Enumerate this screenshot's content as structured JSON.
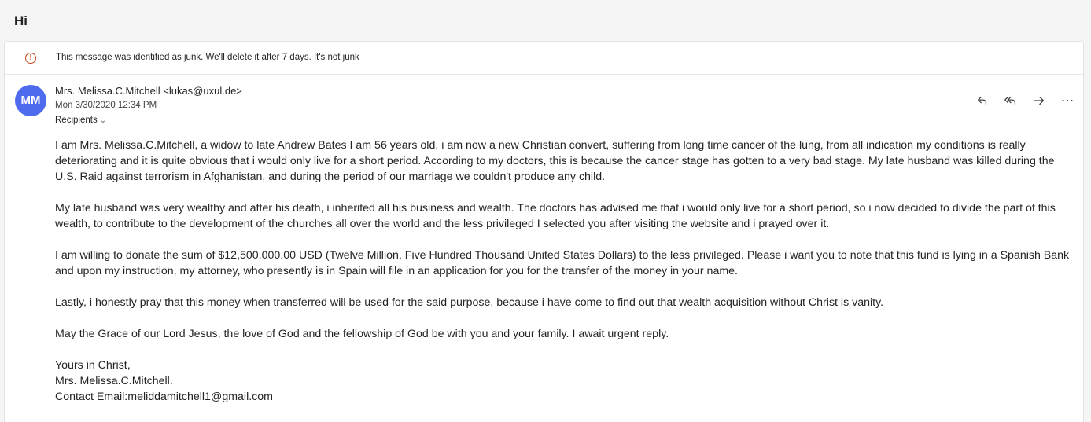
{
  "subject": "Hi",
  "junk_notice": "This message was identified as junk. We'll delete it after 7 days. It's not junk",
  "message": {
    "avatar_initials": "MM",
    "sender": "Mrs. Melissa.C.Mitchell <lukas@uxul.de>",
    "date": "Mon 3/30/2020 12:34 PM",
    "recipients_label": "Recipients",
    "actions": [
      "reply",
      "reply-all",
      "forward",
      "more"
    ],
    "paragraphs": [
      "I am Mrs. Melissa.C.Mitchell, a widow to late Andrew Bates I am 56 years old, i am now a new Christian convert, suffering from long time cancer of the lung, from all indication my conditions is really deteriorating and it is quite obvious that i would only live for a short period. According to my doctors, this is because the cancer stage has gotten to a very bad stage. My late husband was killed during the U.S. Raid against terrorism in Afghanistan, and during the period of our marriage we couldn't produce any child.",
      "My late husband was very wealthy and after his death, i inherited all his business and wealth. The doctors has advised me that i would only live for a short period, so i now decided to divide the part of this wealth, to contribute to the development of the churches all over the world and the less privileged I selected you after visiting the website and i prayed over it.",
      "I am willing to donate the sum of $12,500,000.00 USD (Twelve Million, Five Hundred Thousand United States Dollars) to the less privileged. Please i want you to note that this fund is lying in a Spanish Bank and upon my instruction, my attorney, who presently is in Spain will file in an application for you for the transfer of the money in your name.",
      "Lastly, i honestly pray that this money when transferred will be used for the said purpose, because i have come to find out that wealth acquisition without Christ is vanity.",
      "May the Grace of our Lord Jesus, the love of God and the fellowship of God be with you and your family. I await urgent reply."
    ],
    "signature": {
      "closing": "Yours in Christ,",
      "name": "Mrs. Melissa.C.Mitchell.",
      "contact": "Contact Email:meliddamitchell1@gmail.com"
    }
  },
  "colors": {
    "avatar": "#4f6bed",
    "junk_icon": "#c4471d"
  }
}
